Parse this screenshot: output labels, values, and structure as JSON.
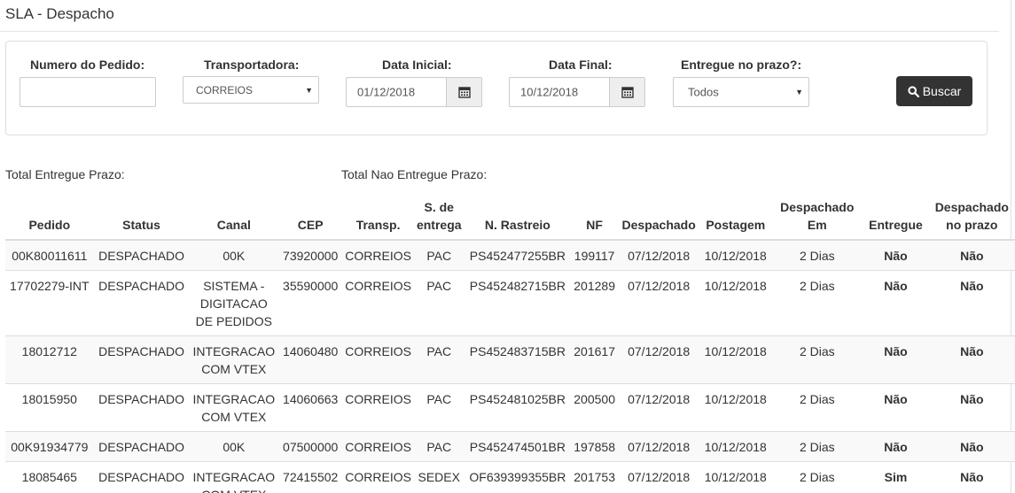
{
  "page": {
    "title": "SLA - Despacho"
  },
  "filters": {
    "pedido": {
      "label": "Numero do Pedido:",
      "value": ""
    },
    "transportadora": {
      "label": "Transportadora:",
      "value": "CORREIOS"
    },
    "data_inicial": {
      "label": "Data Inicial:",
      "value": "01/12/2018"
    },
    "data_final": {
      "label": "Data Final:",
      "value": "10/12/2018"
    },
    "entregue": {
      "label": "Entregue no prazo?:",
      "value": "Todos"
    },
    "buscar_label": "Buscar"
  },
  "totals": {
    "entregue_label": "Total Entregue Prazo:",
    "nao_entregue_label": "Total Nao Entregue Prazo:"
  },
  "table": {
    "headers": [
      "Pedido",
      "Status",
      "Canal",
      "CEP",
      "Transp.",
      "S. de entrega",
      "N. Rastreio",
      "NF",
      "Despachado",
      "Postagem",
      "Despachado Em",
      "Entregue",
      "Despachado no prazo"
    ],
    "rows": [
      [
        "00K80011611",
        "DESPACHADO",
        "00K",
        "73920000",
        "CORREIOS",
        "PAC",
        "PS452477255BR",
        "199117",
        "07/12/2018",
        "10/12/2018",
        "2 Dias",
        "Não",
        "Não"
      ],
      [
        "17702279-INT",
        "DESPACHADO",
        "SISTEMA - DIGITACAO DE PEDIDOS",
        "35590000",
        "CORREIOS",
        "PAC",
        "PS452482715BR",
        "201289",
        "07/12/2018",
        "10/12/2018",
        "2 Dias",
        "Não",
        "Não"
      ],
      [
        "18012712",
        "DESPACHADO",
        "INTEGRACAO COM VTEX",
        "14060480",
        "CORREIOS",
        "PAC",
        "PS452483715BR",
        "201617",
        "07/12/2018",
        "10/12/2018",
        "2 Dias",
        "Não",
        "Não"
      ],
      [
        "18015950",
        "DESPACHADO",
        "INTEGRACAO COM VTEX",
        "14060663",
        "CORREIOS",
        "PAC",
        "PS452481025BR",
        "200500",
        "07/12/2018",
        "10/12/2018",
        "2 Dias",
        "Não",
        "Não"
      ],
      [
        "00K91934779",
        "DESPACHADO",
        "00K",
        "07500000",
        "CORREIOS",
        "PAC",
        "PS452474501BR",
        "197858",
        "07/12/2018",
        "10/12/2018",
        "2 Dias",
        "Não",
        "Não"
      ],
      [
        "18085465",
        "DESPACHADO",
        "INTEGRACAO COM VTEX",
        "72415502",
        "CORREIOS",
        "SEDEX",
        "OF639399355BR",
        "201753",
        "07/12/2018",
        "10/12/2018",
        "2 Dias",
        "Sim",
        "Não"
      ]
    ]
  },
  "icons": {
    "calendar": "calendar-icon",
    "search": "search-icon",
    "caret": "caret-down-icon"
  },
  "colors": {
    "button_bg": "#333333",
    "border": "#dddddd",
    "stripe": "#f9f9f9"
  }
}
